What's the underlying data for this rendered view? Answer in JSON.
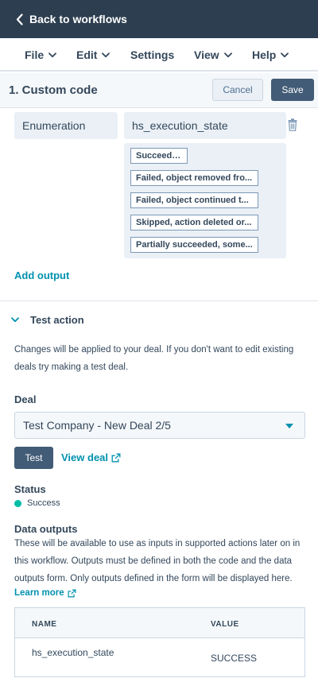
{
  "topbar": {
    "back_label": "Back to workflows"
  },
  "menu": {
    "file": "File",
    "edit": "Edit",
    "settings": "Settings",
    "view": "View",
    "help": "Help"
  },
  "panel": {
    "title": "1. Custom code",
    "cancel_label": "Cancel",
    "save_label": "Save"
  },
  "output": {
    "type": "Enumeration",
    "name": "hs_execution_state",
    "options": [
      "Succeeded",
      "Failed, object removed fro...",
      "Failed, object continued t...",
      "Skipped, action deleted or...",
      "Partially succeeded, some..."
    ],
    "add_output_label": "Add output"
  },
  "test_action": {
    "title": "Test action",
    "description": "Changes will be applied to your deal. If you don't want to edit existing deals try making a test deal.",
    "deal_label": "Deal",
    "deal_value": "Test Company - New Deal 2/5",
    "test_button": "Test",
    "view_deal_link": "View deal",
    "status_label": "Status",
    "status_value": "Success",
    "data_outputs_label": "Data outputs",
    "data_outputs_description": "These will be available to use as inputs in supported actions later on in this workflow. Outputs must be defined in both the code and the data outputs form. Only outputs defined in the form will be displayed here.",
    "learn_more_link": "Learn more"
  },
  "table": {
    "headers": [
      "NAME",
      "VALUE"
    ],
    "rows": [
      {
        "name": "hs_execution_state",
        "value": "SUCCESS"
      }
    ]
  },
  "colors": {
    "topbar": "#2d3e50",
    "link": "#0091ae",
    "primary_button": "#425b76",
    "status_success": "#00bda5"
  },
  "icons": [
    "chevron-left-icon",
    "chevron-down-icon",
    "trash-icon",
    "external-link-icon",
    "caret-down-icon"
  ]
}
